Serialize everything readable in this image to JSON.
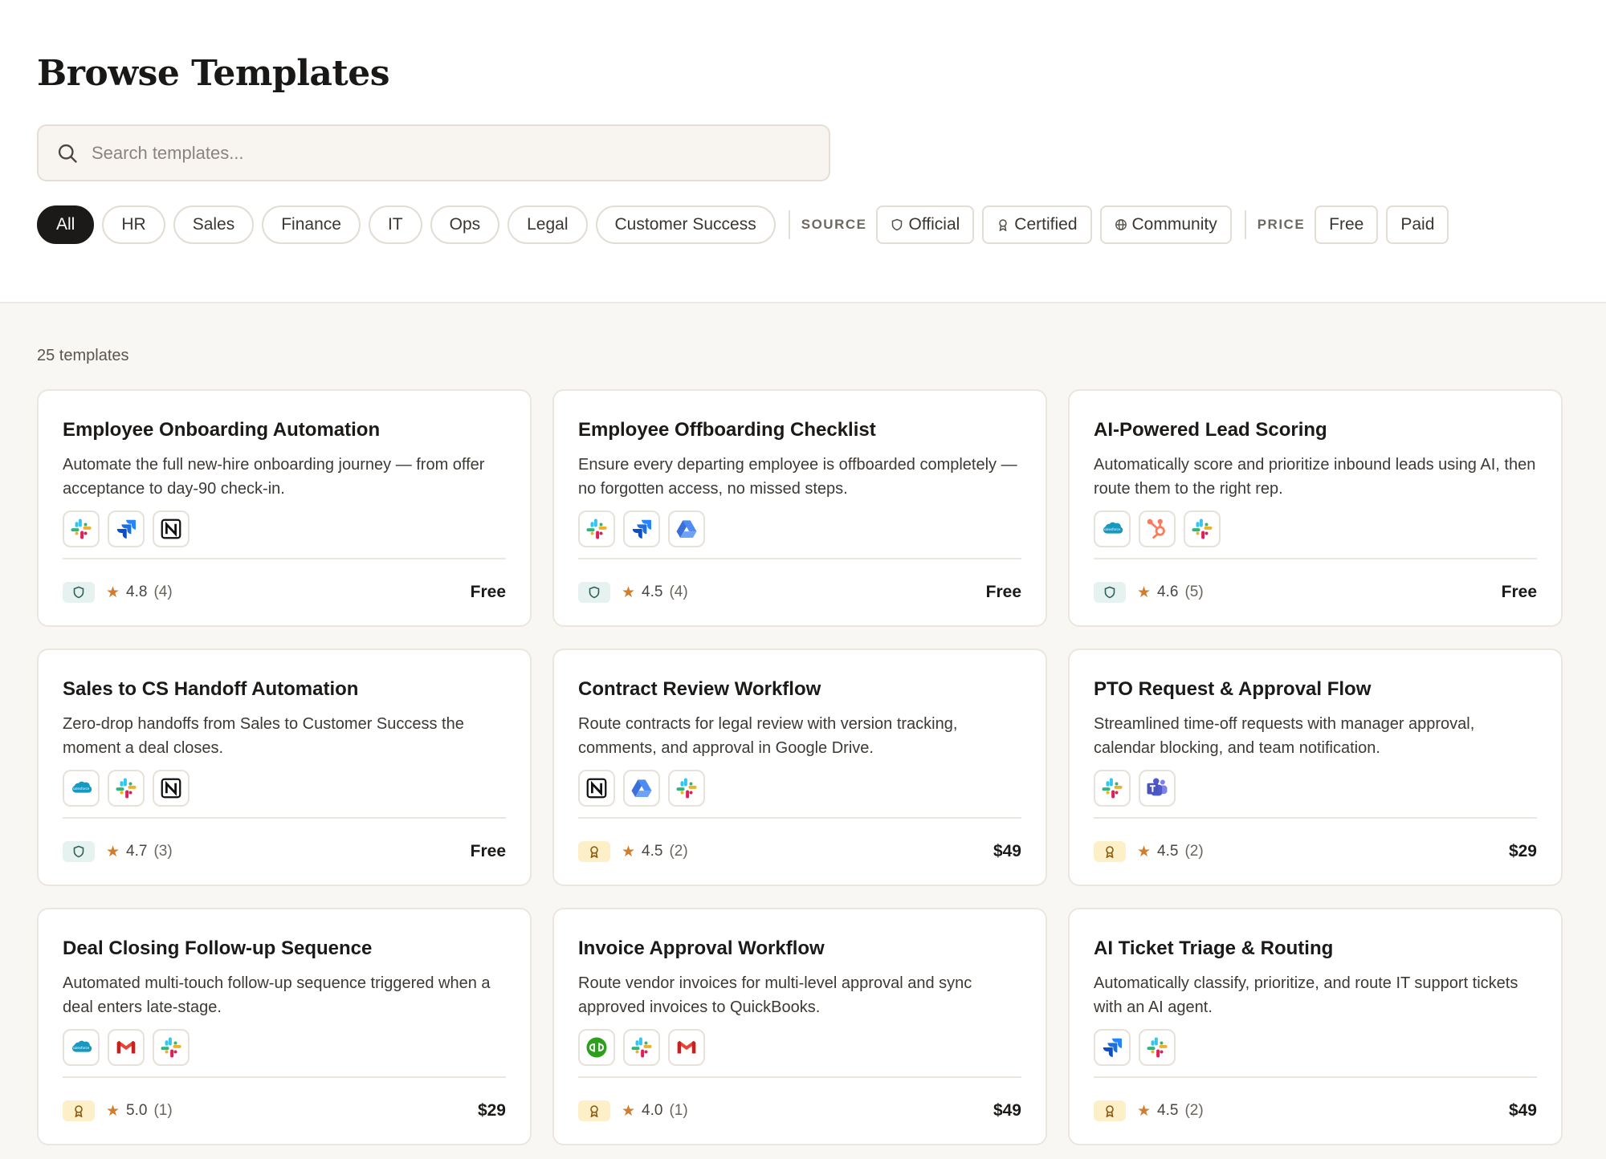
{
  "page_title": "Browse Templates",
  "search": {
    "placeholder": "Search templates..."
  },
  "categories": [
    "All",
    "HR",
    "Sales",
    "Finance",
    "IT",
    "Ops",
    "Legal",
    "Customer Success"
  ],
  "source": {
    "label": "SOURCE",
    "options": [
      {
        "label": "Official",
        "icon": "shield-icon"
      },
      {
        "label": "Certified",
        "icon": "ribbon-icon"
      },
      {
        "label": "Community",
        "icon": "globe-icon"
      }
    ]
  },
  "price_filter": {
    "label": "PRICE",
    "options": [
      "Free",
      "Paid"
    ]
  },
  "results_count": "25 templates",
  "templates": [
    {
      "title": "Employee Onboarding Automation",
      "description": "Automate the full new-hire onboarding journey — from offer acceptance to day-90 check-in.",
      "apps": [
        "slack",
        "jira",
        "notion"
      ],
      "badge": "official",
      "rating": "4.8",
      "reviews": "(4)",
      "price": "Free"
    },
    {
      "title": "Employee Offboarding Checklist",
      "description": "Ensure every departing employee is offboarded completely — no forgotten access, no missed steps.",
      "apps": [
        "slack",
        "jira",
        "google-drive"
      ],
      "badge": "official",
      "rating": "4.5",
      "reviews": "(4)",
      "price": "Free"
    },
    {
      "title": "AI-Powered Lead Scoring",
      "description": "Automatically score and prioritize inbound leads using AI, then route them to the right rep.",
      "apps": [
        "salesforce",
        "hubspot",
        "slack"
      ],
      "badge": "official",
      "rating": "4.6",
      "reviews": "(5)",
      "price": "Free"
    },
    {
      "title": "Sales to CS Handoff Automation",
      "description": "Zero-drop handoffs from Sales to Customer Success the moment a deal closes.",
      "apps": [
        "salesforce",
        "slack",
        "notion"
      ],
      "badge": "official",
      "rating": "4.7",
      "reviews": "(3)",
      "price": "Free"
    },
    {
      "title": "Contract Review Workflow",
      "description": "Route contracts for legal review with version tracking, comments, and approval in Google Drive.",
      "apps": [
        "notion",
        "google-drive",
        "slack"
      ],
      "badge": "certified",
      "rating": "4.5",
      "reviews": "(2)",
      "price": "$49"
    },
    {
      "title": "PTO Request & Approval Flow",
      "description": "Streamlined time-off requests with manager approval, calendar blocking, and team notification.",
      "apps": [
        "slack",
        "teams"
      ],
      "badge": "certified",
      "rating": "4.5",
      "reviews": "(2)",
      "price": "$29"
    },
    {
      "title": "Deal Closing Follow-up Sequence",
      "description": "Automated multi-touch follow-up sequence triggered when a deal enters late-stage.",
      "apps": [
        "salesforce",
        "gmail",
        "slack"
      ],
      "badge": "certified",
      "rating": "5.0",
      "reviews": "(1)",
      "price": "$29"
    },
    {
      "title": "Invoice Approval Workflow",
      "description": "Route vendor invoices for multi-level approval and sync approved invoices to QuickBooks.",
      "apps": [
        "quickbooks",
        "slack",
        "gmail"
      ],
      "badge": "certified",
      "rating": "4.0",
      "reviews": "(1)",
      "price": "$49"
    },
    {
      "title": "AI Ticket Triage & Routing",
      "description": "Automatically classify, prioritize, and route IT support tickets with an AI agent.",
      "apps": [
        "jira",
        "slack"
      ],
      "badge": "certified",
      "rating": "4.5",
      "reviews": "(2)",
      "price": "$49"
    }
  ],
  "colors": {
    "accent_dark": "#1c1a18",
    "star": "#d27c2c",
    "official_badge_bg": "#e6f2ef",
    "certified_badge_bg": "#fdf0c9",
    "page_bg": "#f9f7f4"
  }
}
